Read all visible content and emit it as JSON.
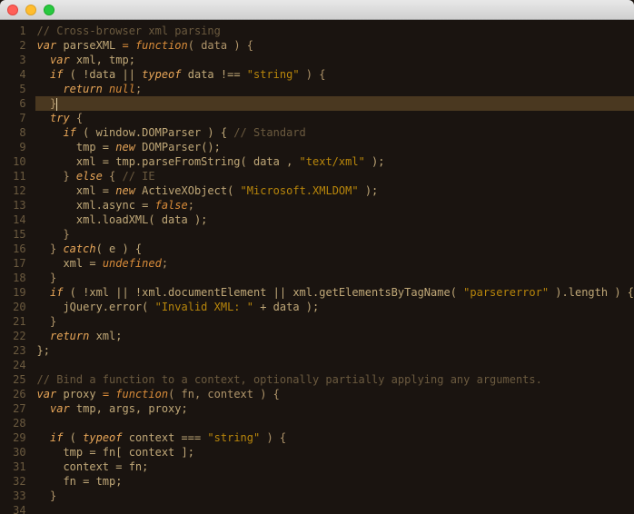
{
  "window": {
    "traffic_lights": [
      "close-button",
      "minimize-button",
      "zoom-button"
    ]
  },
  "editor": {
    "line_numbers": [
      "1",
      "2",
      "3",
      "4",
      "5",
      "6",
      "7",
      "8",
      "9",
      "10",
      "11",
      "12",
      "13",
      "14",
      "15",
      "16",
      "17",
      "18",
      "19",
      "20",
      "21",
      "22",
      "23",
      "24",
      "25",
      "26",
      "27",
      "28",
      "29",
      "30",
      "31",
      "32",
      "33",
      "34"
    ],
    "highlighted_line": 6,
    "lines": {
      "1": {
        "text": "// Cross-browser xml parsing"
      },
      "2": {
        "kw_var": "var",
        "ident": "parseXML",
        "op_eq": " = ",
        "kw_fn": "function",
        "params": "( data ) {"
      },
      "3": {
        "kw_var": "var",
        "rest": " xml, tmp;"
      },
      "4": {
        "kw_if": "if",
        "rest": " ( !data || ",
        "kw_typeof": "typeof",
        "rest2": " data !== ",
        "str": "\"string\"",
        "rest3": " ) {"
      },
      "5": {
        "kw_return": "return",
        "rest": " ",
        "kw_null": "null",
        "semi": ";"
      },
      "6": {
        "brace": "}"
      },
      "7": {
        "kw_try": "try",
        "brace": " {"
      },
      "8": {
        "kw_if": "if",
        "rest": " ( window.DOMParser ) { ",
        "comment": "// Standard"
      },
      "9": {
        "pre": "tmp = ",
        "kw_new": "new",
        "rest": " DOMParser();"
      },
      "10": {
        "text": "xml = tmp.parseFromString( data , ",
        "str": "\"text/xml\"",
        "rest": " );"
      },
      "11": {
        "pre": "} ",
        "kw_else": "else",
        "rest": " { ",
        "comment": "// IE"
      },
      "12": {
        "pre": "xml = ",
        "kw_new": "new",
        "rest": " ActiveXObject( ",
        "str": "\"Microsoft.XMLDOM\"",
        "rest2": " );"
      },
      "13": {
        "pre": "xml.async = ",
        "kw_false": "false",
        "semi": ";"
      },
      "14": {
        "text": "xml.loadXML( data );"
      },
      "15": {
        "brace": "}"
      },
      "16": {
        "pre": "} ",
        "kw_catch": "catch",
        "rest": "( e ) {"
      },
      "17": {
        "pre": "xml = ",
        "kw_undef": "undefined",
        "semi": ";"
      },
      "18": {
        "brace": "}"
      },
      "19": {
        "kw_if": "if",
        "rest": " ( !xml || !xml.documentElement || xml.getElementsByTagName( ",
        "str": "\"parsererror\"",
        "rest2": " ).length ) {"
      },
      "20": {
        "pre": "jQuery.error( ",
        "str": "\"Invalid XML: \"",
        "rest": " + data );"
      },
      "21": {
        "brace": "}"
      },
      "22": {
        "kw_return": "return",
        "rest": " xml;"
      },
      "23": {
        "text": "};"
      },
      "24": {
        "text": ""
      },
      "25": {
        "text": "// Bind a function to a context, optionally partially applying any arguments."
      },
      "26": {
        "kw_var": "var",
        "ident": "proxy",
        "op_eq": " = ",
        "kw_fn": "function",
        "params": "( fn, context ) {"
      },
      "27": {
        "kw_var": "var",
        "rest": " tmp, args, proxy;"
      },
      "28": {
        "text": ""
      },
      "29": {
        "kw_if": "if",
        "rest": " ( ",
        "kw_typeof": "typeof",
        "rest2": " context === ",
        "str": "\"string\"",
        "rest3": " ) {"
      },
      "30": {
        "text": "tmp = fn[ context ];"
      },
      "31": {
        "text": "context = fn;"
      },
      "32": {
        "text": "fn = tmp;"
      },
      "33": {
        "brace": "}"
      },
      "34": {
        "text": ""
      }
    }
  }
}
